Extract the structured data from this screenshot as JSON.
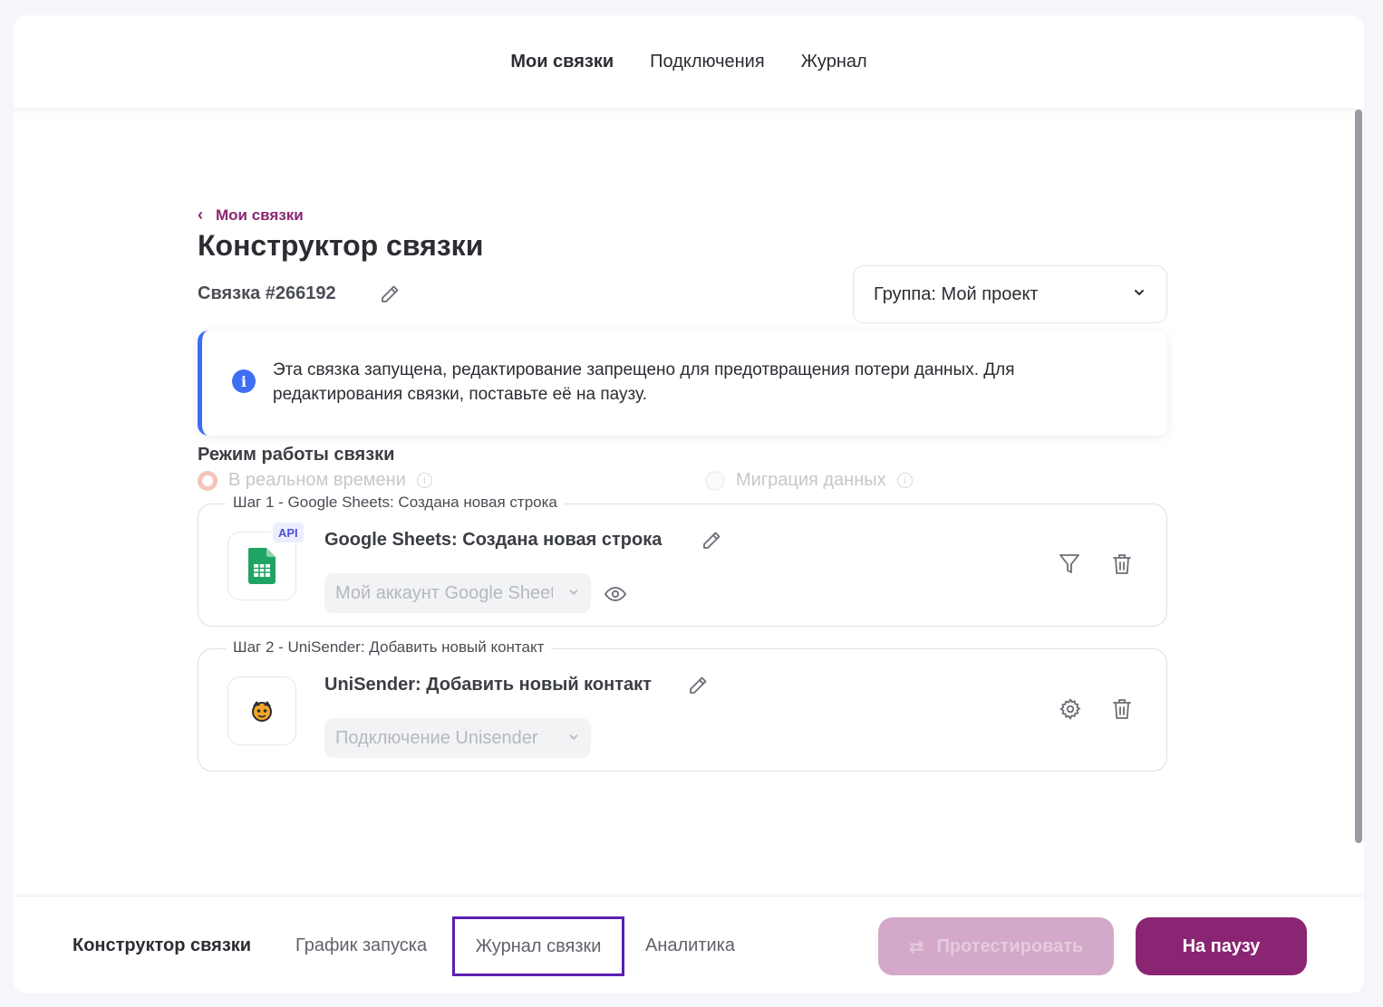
{
  "top_nav": {
    "items": [
      {
        "label": "Мои связки",
        "active": true
      },
      {
        "label": "Подключения",
        "active": false
      },
      {
        "label": "Журнал",
        "active": false
      }
    ]
  },
  "breadcrumb": {
    "back_label": "Мои связки"
  },
  "page": {
    "title": "Конструктор связки",
    "link_id": "Связка #266192",
    "group_select": "Группа: Мой проект"
  },
  "info": {
    "text": "Эта связка запущена, редактирование запрещено для предотвращения потери данных. Для редактирования связки, поставьте её на паузу."
  },
  "mode": {
    "title": "Режим работы связки",
    "options": [
      {
        "label": "В реальном времени",
        "selected": true
      },
      {
        "label": "Миграция данных",
        "selected": false
      }
    ]
  },
  "steps": [
    {
      "legend": "Шаг 1 - Google Sheets: Создана новая строка",
      "title": "Google Sheets: Создана новая строка",
      "badge": "API",
      "account": "Мой аккаунт Google Sheets",
      "icon": "google-sheets-icon"
    },
    {
      "legend": "Шаг 2 - UniSender: Добавить новый контакт",
      "title": "UniSender: Добавить новый контакт",
      "account": "Подключение Unisender",
      "icon": "unisender-icon"
    }
  ],
  "bottom_tabs": [
    {
      "label": "Конструктор связки",
      "active": true
    },
    {
      "label": "График запуска",
      "active": false
    },
    {
      "label": "Журнал связки",
      "active": false
    },
    {
      "label": "Аналитика",
      "active": false
    }
  ],
  "actions": {
    "test_label": "Протестировать",
    "pause_label": "На паузу"
  },
  "colors": {
    "accent": "#8a2573",
    "info_blue": "#3d6ef5",
    "focus_outline": "#5b1fb0"
  }
}
